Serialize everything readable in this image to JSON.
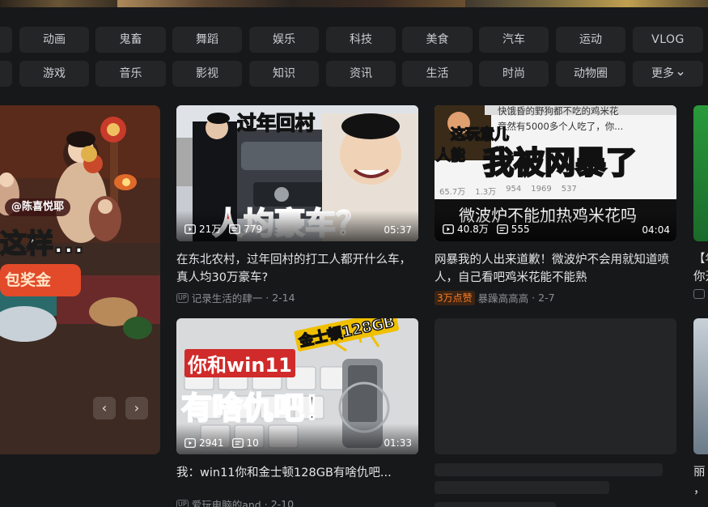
{
  "categories_row1": [
    "动画",
    "鬼畜",
    "舞蹈",
    "娱乐",
    "科技",
    "美食",
    "汽车",
    "运动",
    "VLOG"
  ],
  "categories_row2": [
    "游戏",
    "音乐",
    "影视",
    "知识",
    "资讯",
    "生活",
    "时尚",
    "动物圈",
    "更多"
  ],
  "carousel": {
    "handle": "@陈喜悦耶",
    "title": "这样...",
    "prize": "包奖金",
    "prev_icon": "‹",
    "next_icon": "›"
  },
  "videos": [
    {
      "thumb_caption_top": "过年回村",
      "thumb_caption_bottom": "人均豪车？",
      "views": "21万",
      "danmaku": "779",
      "duration": "05:37",
      "title": "在东北农村，过年回村的打工人都开什么车，真人均30万豪车?",
      "author": "记录生活的肆一",
      "date": "2-14"
    },
    {
      "thumb_caption_top": "这玩意儿",
      "thumb_caption_left": "人能",
      "thumb_caption_main": "我被网暴了",
      "thumb_caption_sub": "微波炉不能加热鸡米花吗",
      "thumb_comment_line1": "快饿昏的野狗都不吃的鸡米花",
      "thumb_comment_line2": "竟然有5000多个人吃了，你...",
      "thumb_stat_views": "65.7万",
      "thumb_stat_likes": "1.3万",
      "thumb_stat_coins": "954",
      "thumb_stat_comments": "1969",
      "thumb_stat_shares": "537",
      "views": "40.8万",
      "danmaku": "555",
      "duration": "04:04",
      "title": "网暴我的人出来道歉！微波炉不会用就知道喷人，自己看吧鸡米花能不能熟",
      "badge": "3万点赞",
      "author": "暴躁高高高",
      "date": "2-7"
    },
    {
      "thumb_caption_tag": "金士顿128GB",
      "thumb_caption_top": "你和win11",
      "thumb_caption_main": "有啥仇吧！",
      "views": "2941",
      "danmaku": "10",
      "duration": "01:33",
      "title": "我：win11你和金士顿128GB有啥仇吧...",
      "author": "爱玩电脑的and",
      "date": "2-10"
    }
  ],
  "partial_right": {
    "title_top": "【年",
    "title_line2": "你开",
    "title_bottom1": "丽",
    "title_bottom2": "，"
  }
}
